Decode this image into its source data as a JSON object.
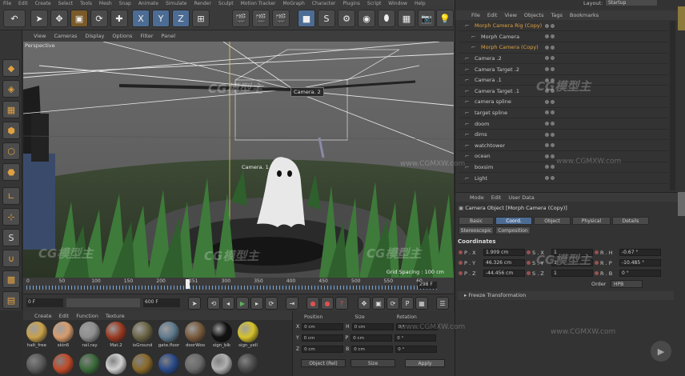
{
  "main_menu": [
    "File",
    "Edit",
    "Create",
    "Select",
    "Tools",
    "Mesh",
    "Snap",
    "Animate",
    "Simulate",
    "Render",
    "Sculpt",
    "Motion Tracker",
    "MoGraph",
    "Character",
    "Plugins",
    "Script",
    "Window",
    "Help"
  ],
  "layout": {
    "label": "Layout:",
    "value": "Startup"
  },
  "axis_buttons": {
    "x": "X",
    "y": "Y",
    "z": "Z"
  },
  "viewport": {
    "menu": [
      "View",
      "Cameras",
      "Display",
      "Options",
      "Filter",
      "Panel"
    ],
    "name": "Perspective",
    "camera2_label": "Camera. 2",
    "camera1_label": "Camera. 1",
    "grid_spacing": "Grid Spacing : 100 cm"
  },
  "timeline": {
    "ticks": [
      "0",
      "50",
      "100",
      "150",
      "200",
      "251",
      "300",
      "350",
      "400",
      "450",
      "500",
      "550",
      "60"
    ],
    "current_frame": "298 F",
    "start_field": "0 F",
    "end_field": "600 F"
  },
  "materials": {
    "menu": [
      "Create",
      "Edit",
      "Function",
      "Texture"
    ],
    "items": [
      {
        "label": "halt_free",
        "color": "#c9a14a"
      },
      {
        "label": "skin6",
        "color": "#d79c6c"
      },
      {
        "label": "rail.ray",
        "color": "#8e8e8e"
      },
      {
        "label": "Mat.2",
        "color": "#9c3a22"
      },
      {
        "label": "isGround",
        "color": "#6b6446"
      },
      {
        "label": "gate.floor",
        "color": "#5f7a8e"
      },
      {
        "label": "doorWoo",
        "color": "#7a5b3e"
      },
      {
        "label": "sign_blk",
        "color": "#111111"
      },
      {
        "label": "sign_yell",
        "color": "#d6c22a"
      }
    ]
  },
  "coord_panel": {
    "headers": [
      "Position",
      "Size",
      "Rotation"
    ],
    "rows": [
      {
        "axis": "X",
        "pos": "0 cm",
        "size_axis": "H",
        "size": "0 cm",
        "rot": "0 °"
      },
      {
        "axis": "Y",
        "pos": "0 cm",
        "size_axis": "P",
        "size": "0 cm",
        "rot": "0 °"
      },
      {
        "axis": "Z",
        "pos": "0 cm",
        "size_axis": "B",
        "size": "0 cm",
        "rot": "0 °"
      }
    ],
    "mode": "Object (Rel)",
    "size_mode": "Size",
    "apply": "Apply"
  },
  "object_manager": {
    "menu": [
      "File",
      "Edit",
      "View",
      "Objects",
      "Tags",
      "Bookmarks"
    ],
    "objects": [
      {
        "name": "Morph Camera Rig (Copy)",
        "indent": 0,
        "highlight": true
      },
      {
        "name": "Morph Camera",
        "indent": 1,
        "highlight": false
      },
      {
        "name": "Morph Camera (Copy)",
        "indent": 1,
        "highlight": true
      },
      {
        "name": "Camera .2",
        "indent": 0,
        "highlight": false
      },
      {
        "name": "Camera Target .2",
        "indent": 0,
        "highlight": false
      },
      {
        "name": "Camera .1",
        "indent": 0,
        "highlight": false
      },
      {
        "name": "Camera Target .1",
        "indent": 0,
        "highlight": false
      },
      {
        "name": "camera spline",
        "indent": 0,
        "highlight": false
      },
      {
        "name": "target spline",
        "indent": 0,
        "highlight": false
      },
      {
        "name": "doom",
        "indent": 0,
        "highlight": false
      },
      {
        "name": "dims",
        "indent": 0,
        "highlight": false
      },
      {
        "name": "watchtower",
        "indent": 0,
        "highlight": false
      },
      {
        "name": "ocean",
        "indent": 0,
        "highlight": false
      },
      {
        "name": "boxsim",
        "indent": 0,
        "highlight": false
      },
      {
        "name": "Light",
        "indent": 0,
        "highlight": false
      }
    ]
  },
  "attributes": {
    "menu": [
      "Mode",
      "Edit",
      "User Data"
    ],
    "title": "Camera Object [Morph Camera (Copy)]",
    "tabs_row1": [
      "Basic",
      "Coord.",
      "Object",
      "Physical",
      "Details"
    ],
    "tabs_row2": [
      "Stereoscopic",
      "Composition"
    ],
    "active_tab": "Coord.",
    "section": "Coordinates",
    "rows": [
      {
        "p_label": "P . X",
        "p_val": "1.909 cm",
        "s_label": "S . X",
        "s_val": "1",
        "r_label": "R . H",
        "r_val": "-0.67 °"
      },
      {
        "p_label": "P . Y",
        "p_val": "46.326 cm",
        "s_label": "S . Y",
        "s_val": "1",
        "r_label": "R . P",
        "r_val": "-10.485 °"
      },
      {
        "p_label": "P . Z",
        "p_val": "-44.456 cm",
        "s_label": "S . Z",
        "s_val": "1",
        "r_label": "R . B",
        "r_val": "0 °"
      }
    ],
    "order_label": "Order",
    "order_value": "HPB",
    "freeze": "Freeze Transformation"
  },
  "watermark": {
    "logo": "CG模型主",
    "url": "www.CGMXW.com"
  },
  "colors": {
    "accent": "#4d6c94",
    "highlight_text": "#e0a040",
    "timeline_blue": "#7aa6d6"
  }
}
